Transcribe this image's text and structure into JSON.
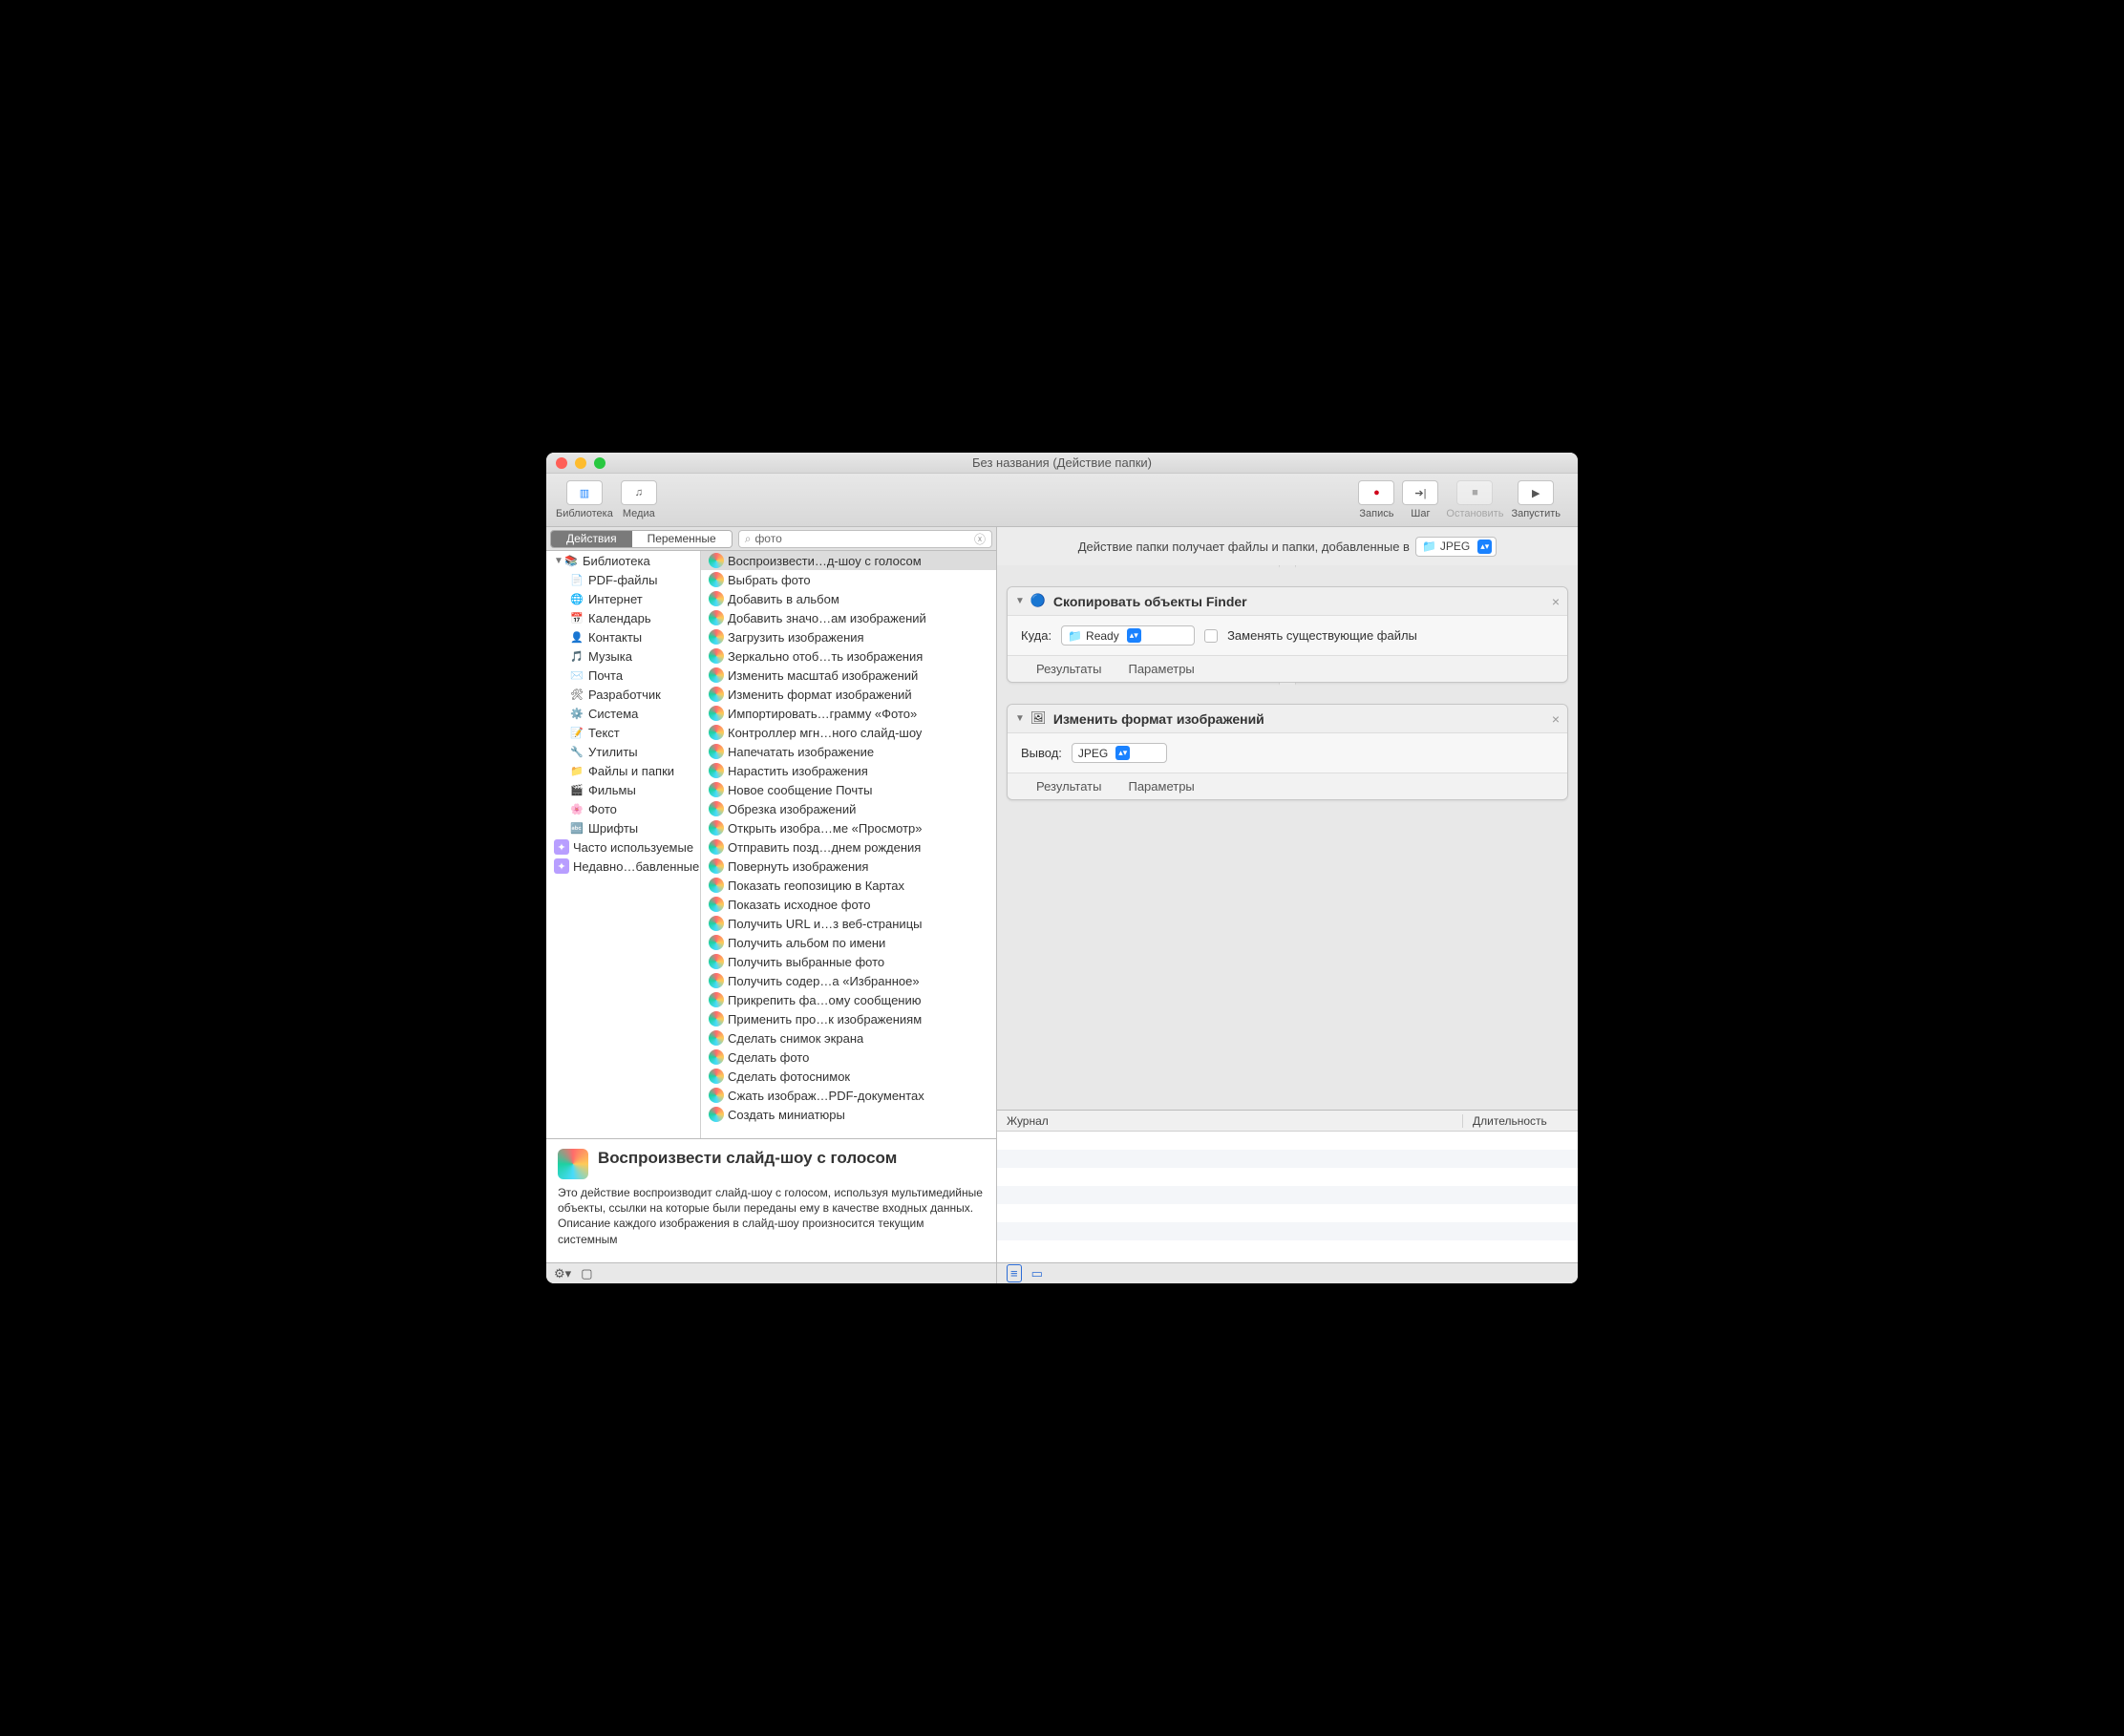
{
  "window": {
    "title": "Без названия (Действие папки)"
  },
  "toolbar": {
    "library": "Библиотека",
    "media": "Медиа",
    "record": "Запись",
    "step": "Шаг",
    "stop": "Остановить",
    "run": "Запустить"
  },
  "tabs": {
    "actions": "Действия",
    "variables": "Переменные"
  },
  "search": {
    "value": "фото"
  },
  "library": {
    "header": "Библиотека",
    "categories": [
      "PDF-файлы",
      "Интернет",
      "Календарь",
      "Контакты",
      "Музыка",
      "Почта",
      "Разработчик",
      "Система",
      "Текст",
      "Утилиты",
      "Файлы и папки",
      "Фильмы",
      "Фото",
      "Шрифты"
    ],
    "smart": [
      "Часто используемые",
      "Недавно…бавленные"
    ]
  },
  "actions_list": [
    "Воспроизвести…д-шоу с голосом",
    "Выбрать фото",
    "Добавить в альбом",
    "Добавить значо…ам изображений",
    "Загрузить изображения",
    "Зеркально отоб…ть изображения",
    "Изменить масштаб изображений",
    "Изменить формат изображений",
    "Импортировать…грамму «Фото»",
    "Контроллер мгн…ного слайд-шоу",
    "Напечатать изображение",
    "Нарастить изображения",
    "Новое сообщение Почты",
    "Обрезка изображений",
    "Открыть изобра…ме «Просмотр»",
    "Отправить позд…днем рождения",
    "Повернуть изображения",
    "Показать геопозицию в Картах",
    "Показать исходное фото",
    "Получить URL и…з веб-страницы",
    "Получить альбом по имени",
    "Получить выбранные фото",
    "Получить содер…а «Избранное»",
    "Прикрепить фа…ому сообщению",
    "Применить про…к изображениям",
    "Сделать снимок экрана",
    "Сделать фото",
    "Сделать фотоснимок",
    "Сжать изображ…PDF-документах",
    "Создать миниатюры"
  ],
  "description": {
    "title": "Воспроизвести слайд-шоу с голосом",
    "body": "Это действие воспроизводит слайд-шоу с голосом, используя мультимедийные объекты, ссылки на которые были переданы ему в качестве входных данных. Описание каждого изображения в слайд-шоу произносится текущим системным"
  },
  "workflow": {
    "receives_label": "Действие папки получает файлы и папки, добавленные в",
    "receives_folder": "JPEG",
    "action1": {
      "title": "Скопировать объекты Finder",
      "where_label": "Куда:",
      "where_value": "Ready",
      "replace_label": "Заменять существующие файлы"
    },
    "action2": {
      "title": "Изменить формат изображений",
      "output_label": "Вывод:",
      "output_value": "JPEG"
    },
    "footer": {
      "results": "Результаты",
      "options": "Параметры"
    }
  },
  "log": {
    "col1": "Журнал",
    "col2": "Длительность"
  }
}
